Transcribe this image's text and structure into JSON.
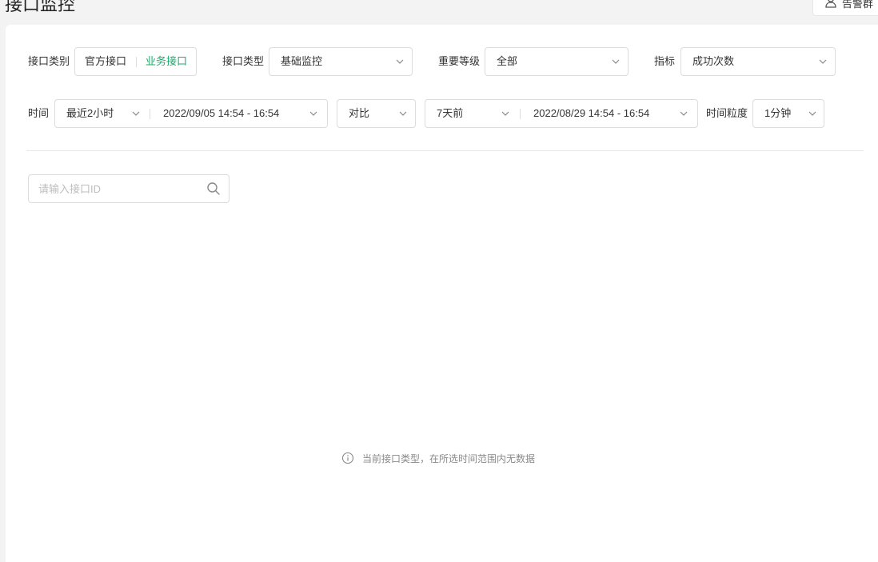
{
  "page": {
    "title": "接口监控"
  },
  "top_right": {
    "label": "告警群"
  },
  "filters": {
    "category": {
      "label": "接口类别",
      "options": [
        "官方接口",
        "业务接口"
      ],
      "selected": "业务接口"
    },
    "type": {
      "label": "接口类型",
      "value": "基础监控"
    },
    "level": {
      "label": "重要等级",
      "value": "全部"
    },
    "metric": {
      "label": "指标",
      "value": "成功次数"
    },
    "time": {
      "label": "时间",
      "preset": "最近2小时",
      "range": "2022/09/05 14:54 - 16:54"
    },
    "compare": {
      "value": "对比"
    },
    "compare_time": {
      "preset": "7天前",
      "range": "2022/08/29 14:54 - 16:54"
    },
    "granularity": {
      "label": "时间粒度",
      "value": "1分钟"
    }
  },
  "search": {
    "placeholder": "请输入接口ID"
  },
  "empty_state": {
    "message": "当前接口类型，在所选时间范围内无数据"
  },
  "colors": {
    "accent": "#1aad6b",
    "border": "#dcdcdc",
    "muted": "#8a8a8a"
  }
}
